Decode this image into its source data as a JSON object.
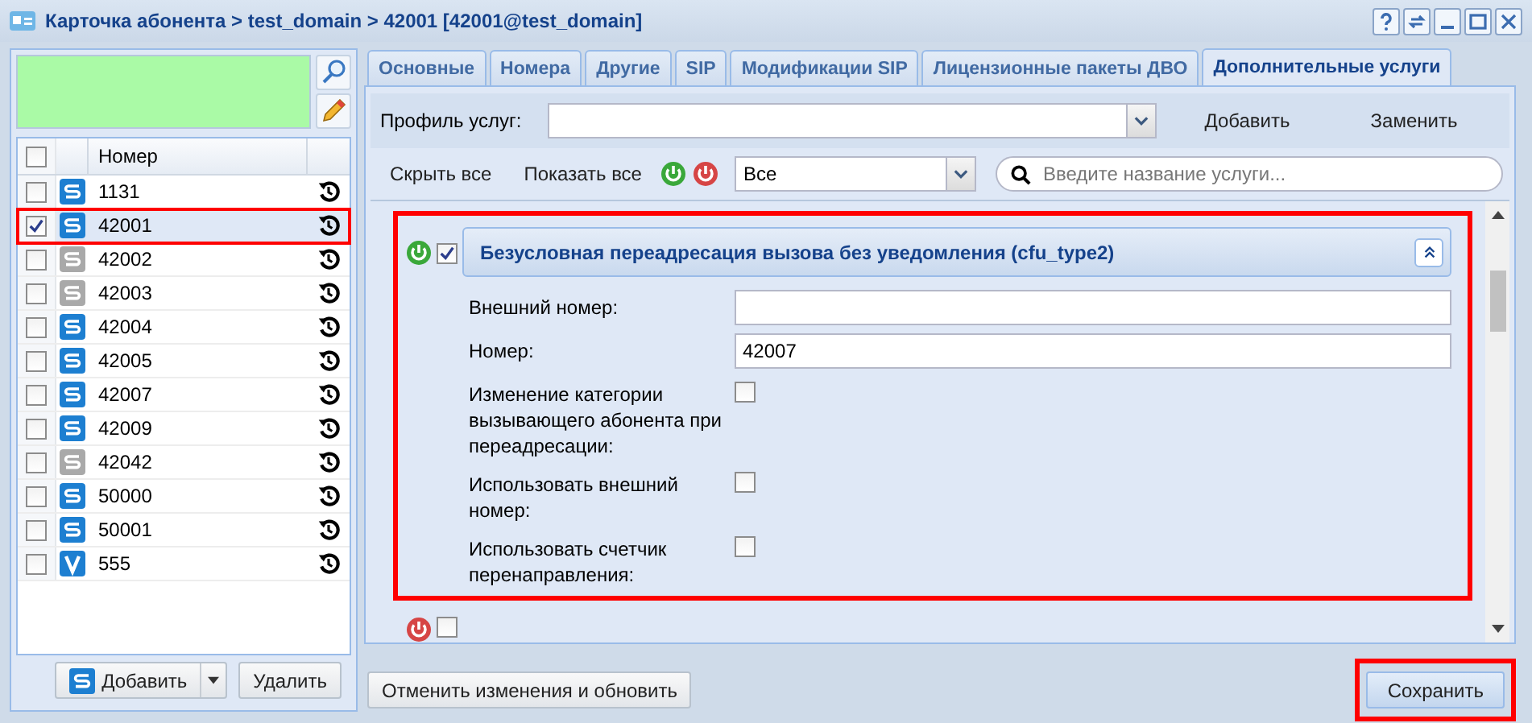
{
  "window": {
    "title": "Карточка абонента > test_domain > 42001 [42001@test_domain]"
  },
  "subscribers": {
    "column": "Номер",
    "all_checked": false,
    "rows": [
      {
        "number": "1131",
        "kind": "sip",
        "active": true,
        "checked": false,
        "selected": false
      },
      {
        "number": "42001",
        "kind": "sip",
        "active": true,
        "checked": true,
        "selected": true
      },
      {
        "number": "42002",
        "kind": "sip",
        "active": false,
        "checked": false,
        "selected": false
      },
      {
        "number": "42003",
        "kind": "sip",
        "active": false,
        "checked": false,
        "selected": false
      },
      {
        "number": "42004",
        "kind": "sip",
        "active": true,
        "checked": false,
        "selected": false
      },
      {
        "number": "42005",
        "kind": "sip",
        "active": true,
        "checked": false,
        "selected": false
      },
      {
        "number": "42007",
        "kind": "sip",
        "active": true,
        "checked": false,
        "selected": false
      },
      {
        "number": "42009",
        "kind": "sip",
        "active": true,
        "checked": false,
        "selected": false
      },
      {
        "number": "42042",
        "kind": "sip",
        "active": false,
        "checked": false,
        "selected": false
      },
      {
        "number": "50000",
        "kind": "sip",
        "active": true,
        "checked": false,
        "selected": false
      },
      {
        "number": "50001",
        "kind": "sip",
        "active": true,
        "checked": false,
        "selected": false
      },
      {
        "number": "555",
        "kind": "virtual",
        "active": true,
        "checked": false,
        "selected": false
      }
    ],
    "add_button": "Добавить",
    "delete_button": "Удалить"
  },
  "tabs": [
    {
      "label": "Основные",
      "selected": false
    },
    {
      "label": "Номера",
      "selected": false
    },
    {
      "label": "Другие",
      "selected": false
    },
    {
      "label": "SIP",
      "selected": false
    },
    {
      "label": "Модификации SIP",
      "selected": false
    },
    {
      "label": "Лицензионные пакеты ДВО",
      "selected": false
    },
    {
      "label": "Дополнительные услуги",
      "selected": true
    }
  ],
  "profile": {
    "label": "Профиль услуг:",
    "add": "Добавить",
    "replace": "Заменить"
  },
  "toolbar": {
    "hide_all": "Скрыть все",
    "show_all": "Показать все",
    "filter": "Все",
    "search_placeholder": "Введите название услуги..."
  },
  "service": {
    "title": "Безусловная переадресация вызова без уведомления (cfu_type2)",
    "enabled": true,
    "checked": true,
    "fields": [
      {
        "kind": "text",
        "label": "Внешний номер:"
      },
      {
        "kind": "text",
        "label": "Номер:",
        "value": "42007"
      },
      {
        "kind": "checkbox",
        "label": "Изменение категории вызывающего абонента при переадресации:",
        "checked": false
      },
      {
        "kind": "checkbox",
        "label": "Использовать внешний номер:",
        "checked": false
      },
      {
        "kind": "checkbox",
        "label": "Использовать счетчик перенаправления:",
        "checked": false
      }
    ]
  },
  "next_service": {
    "enabled": false,
    "checked": false
  },
  "footer": {
    "cancel": "Отменить изменения и обновить",
    "save": "Сохранить"
  }
}
